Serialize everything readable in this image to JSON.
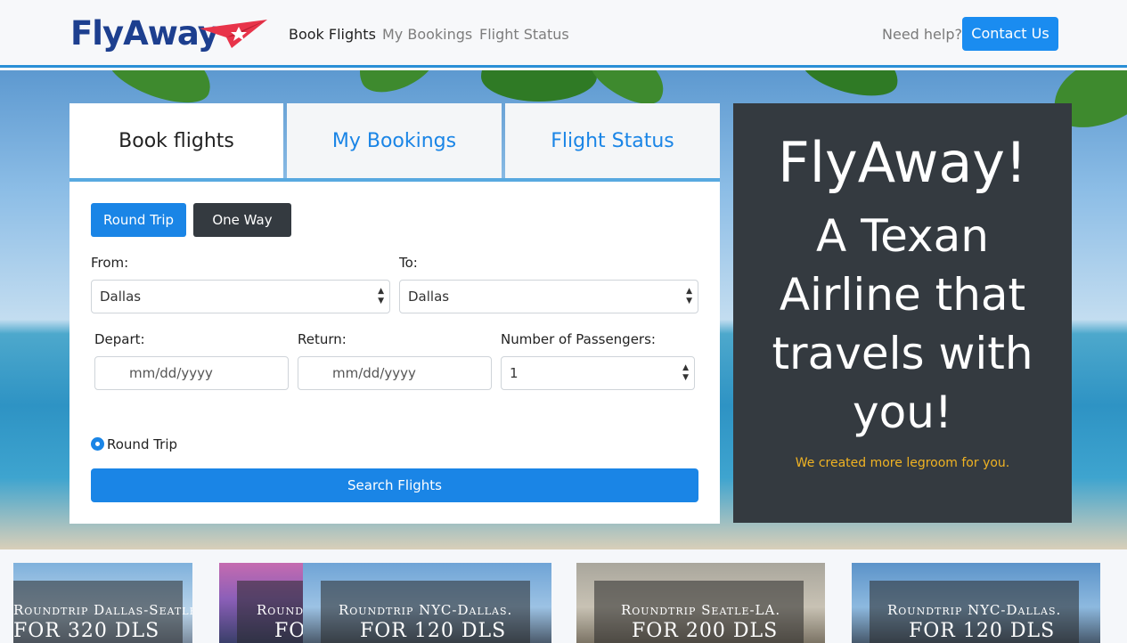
{
  "brand": {
    "name": "FlyAway",
    "primary_color": "#1d3f8f",
    "accent_color": "#e8344a"
  },
  "nav": {
    "links": [
      {
        "label": "Book Flights",
        "active": true
      },
      {
        "label": "My Bookings",
        "active": false
      },
      {
        "label": "Flight Status",
        "active": false
      }
    ],
    "help_text": "Need help?",
    "contact_label": "Contact Us"
  },
  "tabs": [
    {
      "label": "Book flights",
      "active": true
    },
    {
      "label": "My Bookings",
      "active": false
    },
    {
      "label": "Flight Status",
      "active": false
    }
  ],
  "form": {
    "trip_buttons": {
      "round_trip": "Round Trip",
      "one_way": "One Way"
    },
    "from_label": "From:",
    "from_value": "Dallas",
    "to_label": "To:",
    "to_value": "Dallas",
    "depart_label": "Depart:",
    "depart_placeholder": "mm/dd/yyyy",
    "return_label": "Return:",
    "return_placeholder": "mm/dd/yyyy",
    "passengers_label": "Number of Passengers:",
    "passengers_value": "1",
    "radio_label": "Round Trip",
    "search_label": "Search Flights"
  },
  "promo": {
    "title": "FlyAway!",
    "subtitle": "A Texan Airline that travels with you!",
    "note": "We created more legroom for you."
  },
  "deals": [
    {
      "route": "Roundtrip Dallas-Seatle.",
      "price": "FOR 320 DLS"
    },
    {
      "route": "Roundtrip",
      "price": "FOR"
    },
    {
      "route": "Roundtrip NYC-Dallas.",
      "price": "FOR 120 DLS"
    },
    {
      "route": "Roundtrip Seatle-LA.",
      "price": "FOR 200 DLS"
    },
    {
      "route": "Roundtrip NYC-Dallas.",
      "price": "FOR 120 DLS"
    }
  ]
}
